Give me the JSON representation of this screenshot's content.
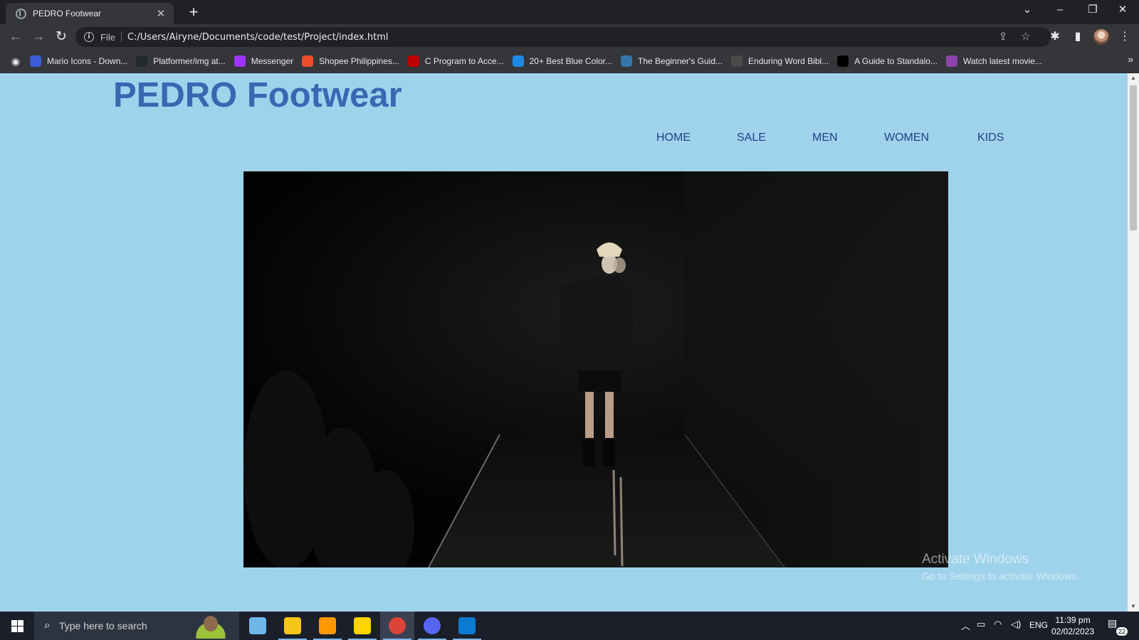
{
  "browser": {
    "tab_title": "PEDRO Footwear",
    "address_prefix": "File",
    "url": "C:/Users/Airyne/Documents/code/test/Project/index.html",
    "bookmarks": [
      {
        "label": "Mario Icons - Down...",
        "icon": "star-icon",
        "color": "#3b5bdb"
      },
      {
        "label": "Platformer/img at...",
        "icon": "github-icon",
        "color": "#24292e"
      },
      {
        "label": "Messenger",
        "icon": "messenger-icon",
        "color": "#a033ff"
      },
      {
        "label": "Shopee Philippines...",
        "icon": "shopee-icon",
        "color": "#ee4d2d"
      },
      {
        "label": "C Program to Acce...",
        "icon": "tg-icon",
        "color": "#c00000"
      },
      {
        "label": "20+ Best Blue Color...",
        "icon": "blue-circle-icon",
        "color": "#1e88e5"
      },
      {
        "label": "The Beginner's Guid...",
        "icon": "python-icon",
        "color": "#3776ab"
      },
      {
        "label": "Enduring Word Bibl...",
        "icon": "book-icon",
        "color": "#4a4a4a"
      },
      {
        "label": "A Guide to Standalo...",
        "icon": "medium-icon",
        "color": "#000000"
      },
      {
        "label": "Watch latest movie...",
        "icon": "movie-icon",
        "color": "#8e44ad"
      }
    ]
  },
  "page": {
    "site_title": "PEDRO Footwear",
    "nav": [
      "HOME",
      "SALE",
      "MEN",
      "WOMEN",
      "KIDS"
    ],
    "watermark_line1": "Activate Windows",
    "watermark_line2": "Go to Settings to activate Windows."
  },
  "taskbar": {
    "search_placeholder": "Type here to search",
    "language": "ENG",
    "time": "11:39 pm",
    "date": "02/02/2023",
    "notification_count": "22",
    "apps": [
      {
        "name": "notepad-app",
        "color": "#6fb7e9"
      },
      {
        "name": "file-explorer-app",
        "color": "#f5c518"
      },
      {
        "name": "sublime-text-app",
        "color": "#ff9800"
      },
      {
        "name": "sticky-notes-app",
        "color": "#ffd400"
      },
      {
        "name": "chrome-app",
        "color": "#db4437"
      },
      {
        "name": "discord-app",
        "color": "#5865f2"
      },
      {
        "name": "vscode-app",
        "color": "#0a7bd1"
      }
    ]
  }
}
